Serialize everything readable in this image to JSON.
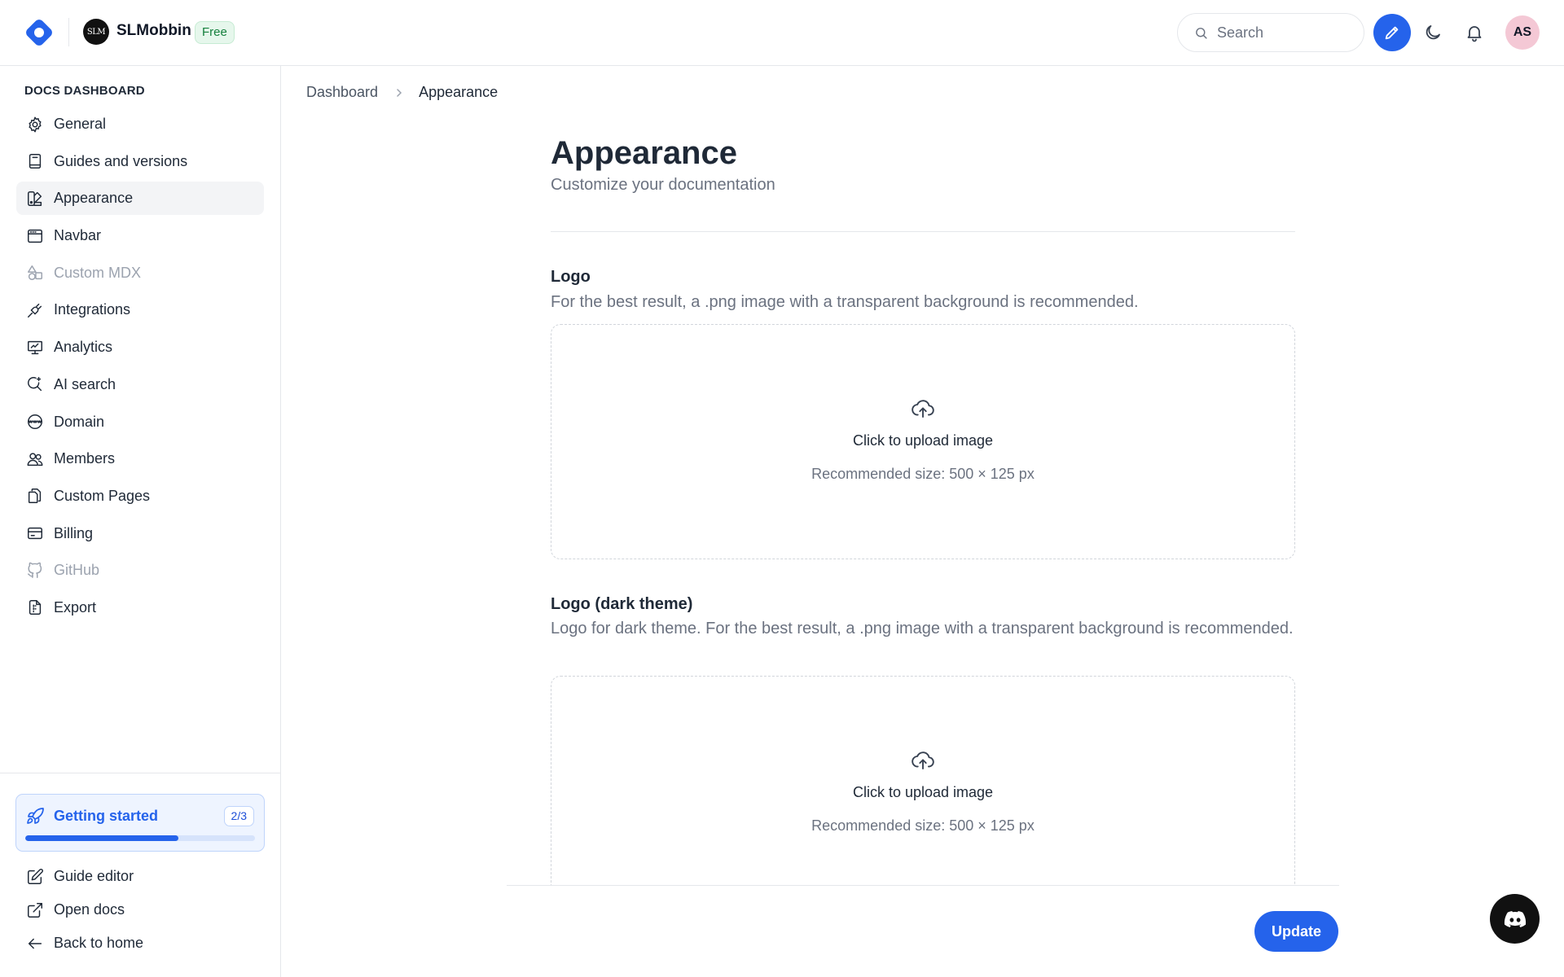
{
  "header": {
    "org_avatar_text": "SLM",
    "org_name": "SLMobbin",
    "plan_badge": "Free",
    "search_placeholder": "Search",
    "user_initials": "AS"
  },
  "sidebar": {
    "heading": "DOCS DASHBOARD",
    "items": [
      {
        "label": "General",
        "icon": "gear-icon",
        "state": "normal"
      },
      {
        "label": "Guides and versions",
        "icon": "book-icon",
        "state": "normal"
      },
      {
        "label": "Appearance",
        "icon": "palette-icon",
        "state": "active"
      },
      {
        "label": "Navbar",
        "icon": "browser-window-icon",
        "state": "normal"
      },
      {
        "label": "Custom MDX",
        "icon": "shapes-icon",
        "state": "disabled"
      },
      {
        "label": "Integrations",
        "icon": "plug-icon",
        "state": "normal"
      },
      {
        "label": "Analytics",
        "icon": "presentation-chart-icon",
        "state": "normal"
      },
      {
        "label": "AI search",
        "icon": "ai-search-icon",
        "state": "normal"
      },
      {
        "label": "Domain",
        "icon": "globe-www-icon",
        "state": "normal"
      },
      {
        "label": "Members",
        "icon": "users-icon",
        "state": "normal"
      },
      {
        "label": "Custom Pages",
        "icon": "pages-icon",
        "state": "normal"
      },
      {
        "label": "Billing",
        "icon": "credit-card-icon",
        "state": "normal"
      },
      {
        "label": "GitHub",
        "icon": "github-icon",
        "state": "disabled"
      },
      {
        "label": "Export",
        "icon": "file-export-icon",
        "state": "normal"
      }
    ],
    "getting_started": {
      "label": "Getting started",
      "count": "2/3",
      "progress": 0.667
    },
    "bottom_links": [
      {
        "label": "Guide editor",
        "icon": "edit-square-icon"
      },
      {
        "label": "Open docs",
        "icon": "external-link-icon"
      },
      {
        "label": "Back to home",
        "icon": "arrow-left-icon"
      }
    ]
  },
  "breadcrumb": {
    "parent": "Dashboard",
    "current": "Appearance"
  },
  "page": {
    "title": "Appearance",
    "subtitle": "Customize your documentation"
  },
  "sections": {
    "logo": {
      "title": "Logo",
      "description": "For the best result, a .png image with a transparent background is recommended.",
      "upload_label": "Click to upload image",
      "upload_hint": "Recommended size: 500 × 125 px"
    },
    "logo_dark": {
      "title": "Logo (dark theme)",
      "description": "Logo for dark theme. For the best result, a .png image with a transparent background is recommended.",
      "upload_label": "Click to upload image",
      "upload_hint": "Recommended size: 500 × 125 px"
    }
  },
  "footer": {
    "update_label": "Update"
  },
  "colors": {
    "accent": "#2563eb",
    "badge_green": "#15803d",
    "muted_text": "#6b7280"
  }
}
